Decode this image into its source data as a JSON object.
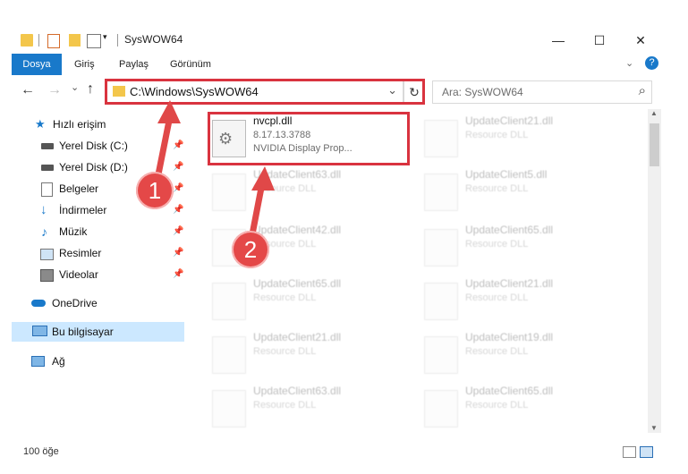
{
  "titlebar": {
    "title": "SysWOW64",
    "minimize": "—",
    "maximize": "☐",
    "close": "✕"
  },
  "ribbon": {
    "tabs": [
      {
        "label": "Dosya",
        "active": true
      },
      {
        "label": "Giriş"
      },
      {
        "label": "Paylaş"
      },
      {
        "label": "Görünüm"
      }
    ],
    "help": "?"
  },
  "navigation": {
    "back": "←",
    "forward": "→",
    "recent": "⌄",
    "up": "↑"
  },
  "address": {
    "path": "C:\\Windows\\SysWOW64",
    "dropdown": "⌄",
    "refresh": "↻"
  },
  "search": {
    "placeholder": "Ara: SysWOW64",
    "icon": "⌕"
  },
  "sidebar": {
    "items": [
      {
        "label": "Hızlı erişim",
        "icon": "star-icon"
      },
      {
        "label": "Yerel Disk (C:)",
        "icon": "drive-icon",
        "pinned": true
      },
      {
        "label": "Yerel Disk (D:)",
        "icon": "drive-icon",
        "pinned": true
      },
      {
        "label": "Belgeler",
        "icon": "documents-icon",
        "pinned": true
      },
      {
        "label": "İndirmeler",
        "icon": "download-icon",
        "pinned": true
      },
      {
        "label": "Müzik",
        "icon": "music-icon",
        "pinned": true
      },
      {
        "label": "Resimler",
        "icon": "pictures-icon",
        "pinned": true
      },
      {
        "label": "Videolar",
        "icon": "videos-icon",
        "pinned": true
      },
      {
        "label": "OneDrive",
        "icon": "cloud-icon"
      },
      {
        "label": "Bu bilgisayar",
        "icon": "computer-icon",
        "selected": true
      },
      {
        "label": "Ağ",
        "icon": "network-icon"
      }
    ]
  },
  "files": {
    "highlighted": {
      "name": "nvcpl.dll",
      "version": "8.17.13.3788",
      "description": "NVIDIA Display Prop..."
    },
    "faded_left": [
      {
        "name": "UpdateClient63.dll",
        "desc": "Resource DLL"
      },
      {
        "name": "UpdateClient42.dll",
        "desc": "Resource DLL"
      },
      {
        "name": "UpdateClient65.dll",
        "desc": "Resource DLL"
      },
      {
        "name": "UpdateClient21.dll",
        "desc": "Resource DLL"
      },
      {
        "name": "UpdateClient63.dll",
        "desc": "Resource DLL"
      }
    ],
    "faded_right": [
      {
        "name": "UpdateClient21.dll",
        "desc": "Resource DLL"
      },
      {
        "name": "UpdateClient5.dll",
        "desc": "Resource DLL"
      },
      {
        "name": "UpdateClient65.dll",
        "desc": "Resource DLL"
      },
      {
        "name": "UpdateClient21.dll",
        "desc": "Resource DLL"
      },
      {
        "name": "UpdateClient19.dll",
        "desc": "Resource DLL"
      },
      {
        "name": "UpdateClient65.dll",
        "desc": "Resource DLL"
      }
    ]
  },
  "annotations": {
    "step1": "1",
    "step2": "2",
    "color": "#e04848"
  },
  "status": {
    "item_count": "100 öğe"
  }
}
